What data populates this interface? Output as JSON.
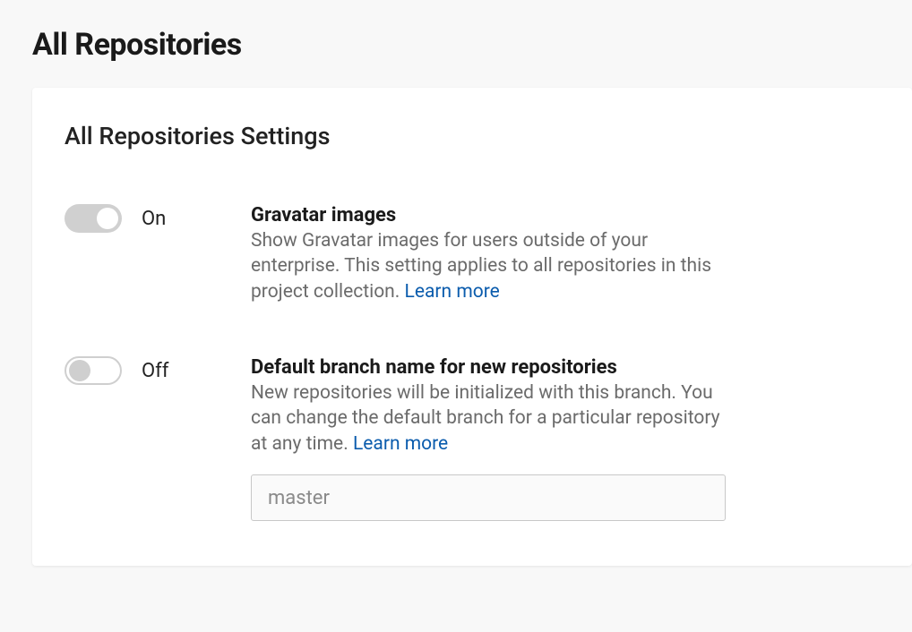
{
  "page": {
    "title": "All Repositories"
  },
  "card": {
    "title": "All Repositories Settings"
  },
  "settings": {
    "gravatar": {
      "toggle_state": "On",
      "title": "Gravatar images",
      "description": "Show Gravatar images for users outside of your enterprise. This setting applies to all repositories in this project collection. ",
      "learn_more": "Learn more"
    },
    "default_branch": {
      "toggle_state": "Off",
      "title": "Default branch name for new repositories",
      "description": "New repositories will be initialized with this branch. You can change the default branch for a particular repository at any time. ",
      "learn_more": "Learn more",
      "input_placeholder": "master",
      "input_value": ""
    }
  }
}
